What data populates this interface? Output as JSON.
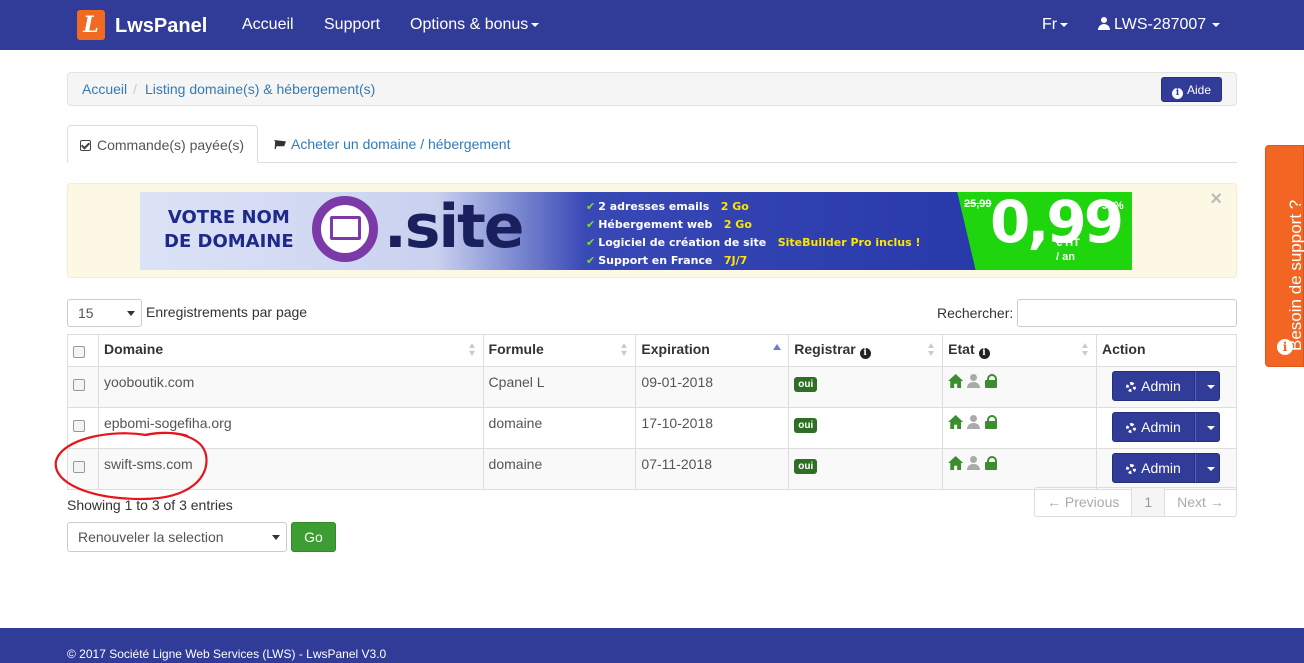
{
  "navbar": {
    "brand_logo_letter": "L",
    "brand": "LwsPanel",
    "links": [
      "Accueil",
      "Support",
      "Options & bonus"
    ],
    "language": "Fr",
    "user": "LWS-287007",
    "bg_color": "#313c99"
  },
  "breadcrumb": {
    "items": [
      "Accueil",
      "Listing domaine(s) & hébergement(s)"
    ],
    "separator": "/",
    "help_label": "Aide"
  },
  "tabs": {
    "active": "Commande(s) payée(s)",
    "link": "Acheter un domaine / hébergement"
  },
  "banner": {
    "line1": "VOTRE NOM",
    "line2": "DE DOMAINE",
    "tld": ".site",
    "features": [
      {
        "text": "2 adresses emails",
        "highlight": "2 Go"
      },
      {
        "text": "Hébergement web",
        "highlight": "2 Go"
      },
      {
        "text": "Logiciel de création de site",
        "highlight": "SiteBuilder Pro inclus !"
      },
      {
        "text": "Support en France",
        "highlight": "7J/7"
      }
    ],
    "old_price": "25,99",
    "discount": "-90%",
    "price": "0,99",
    "price_unit_1": "€ HT",
    "price_unit_2": "/ an",
    "close": "×"
  },
  "controls": {
    "page_size": "15",
    "page_size_label": "Enregistrements par page",
    "search_label": "Rechercher:",
    "search_value": ""
  },
  "table": {
    "headers": [
      "Domaine",
      "Formule",
      "Expiration",
      "Registrar",
      "Etat",
      "Action"
    ],
    "rows": [
      {
        "domain": "yooboutik.com",
        "formula": "Cpanel L",
        "expiration": "09-01-2018",
        "registrar": "oui",
        "action": "Admin"
      },
      {
        "domain": "epbomi-sogefiha.org",
        "formula": "domaine",
        "expiration": "17-10-2018",
        "registrar": "oui",
        "action": "Admin"
      },
      {
        "domain": "swift-sms.com",
        "formula": "domaine",
        "expiration": "07-11-2018",
        "registrar": "oui",
        "action": "Admin"
      }
    ]
  },
  "footer_info": {
    "showing": "Showing 1 to 3 of 3 entries",
    "bulk_action": "Renouveler la selection",
    "go": "Go",
    "pager": {
      "prev": "← Previous",
      "page": "1",
      "next": "Next →"
    }
  },
  "footer": {
    "copyright": "© 2017 Société Ligne Web Services (LWS) - LwsPanel V3.0"
  },
  "support_tab": {
    "label": "Besoin de support ?",
    "icon": "i"
  }
}
